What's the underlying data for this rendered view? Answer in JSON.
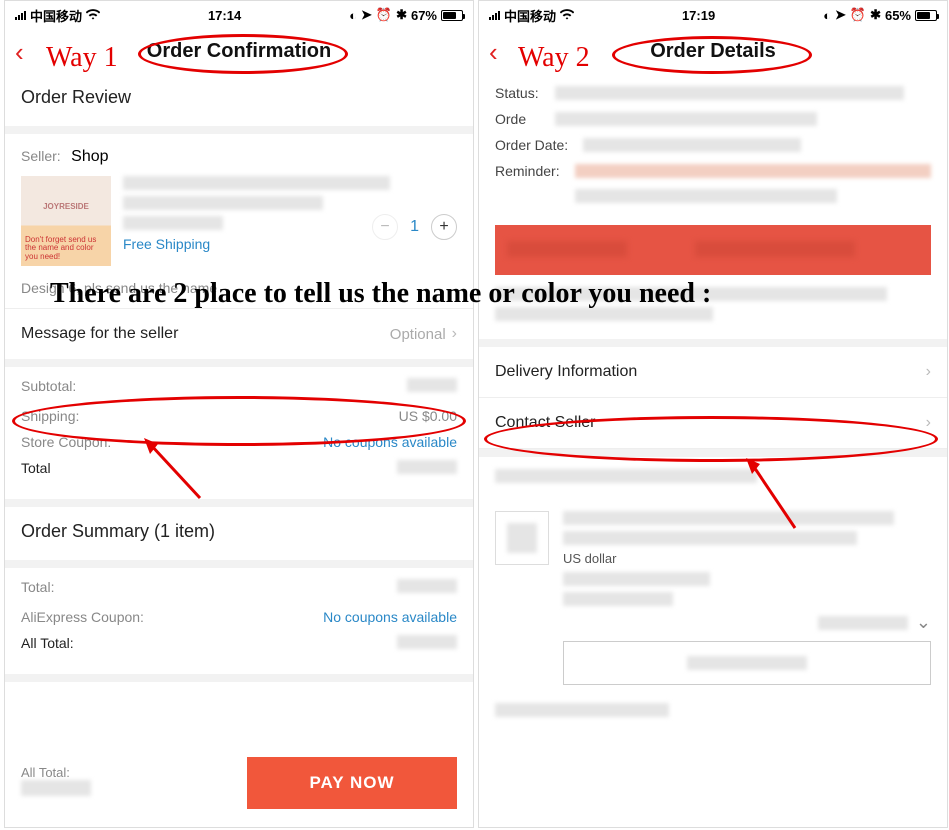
{
  "annotation": {
    "way1": "Way 1",
    "way2": "Way 2",
    "headline": "There are 2 place to tell us the name or color you need :"
  },
  "left": {
    "status": {
      "carrier": "中国移动",
      "time": "17:14",
      "battery": "67%",
      "battery_fill": 67
    },
    "header": {
      "title": "Order Confirmation"
    },
    "review_title": "Order Review",
    "seller_label": "Seller:",
    "seller_value": "Shop",
    "thumb_brand": "JOYRESIDE",
    "thumb_note": "Don't forget send us the name and color you need!",
    "free_ship": "Free Shipping",
    "quantity": "1",
    "variant_note": "Design 6, pls send us the name",
    "msg_label": "Message for the seller",
    "msg_optional": "Optional",
    "totals": {
      "subtotal_lbl": "Subtotal:",
      "shipping_lbl": "Shipping:",
      "shipping_val": "US $0.00",
      "store_coupon_lbl": "Store Coupon:",
      "store_coupon_val": "No coupons available",
      "total_lbl": "Total"
    },
    "summary_title": "Order Summary (1 item)",
    "summary": {
      "total_lbl": "Total:",
      "ali_coupon_lbl": "AliExpress Coupon:",
      "ali_coupon_val": "No coupons available",
      "all_total_lbl": "All Total:"
    },
    "pay": {
      "all_total_lbl": "All Total:",
      "btn": "PAY NOW"
    }
  },
  "right": {
    "status": {
      "carrier": "中国移动",
      "time": "17:19",
      "battery": "65%",
      "battery_fill": 65
    },
    "header": {
      "title": "Order Details"
    },
    "info": {
      "status_lbl": "Status:",
      "order_lbl": "Orde",
      "order_date_lbl": "Order Date:",
      "reminder_lbl": "Reminder:"
    },
    "rows": {
      "delivery": "Delivery Information",
      "contact": "Contact Seller"
    },
    "currency_hint": "US dollar"
  }
}
